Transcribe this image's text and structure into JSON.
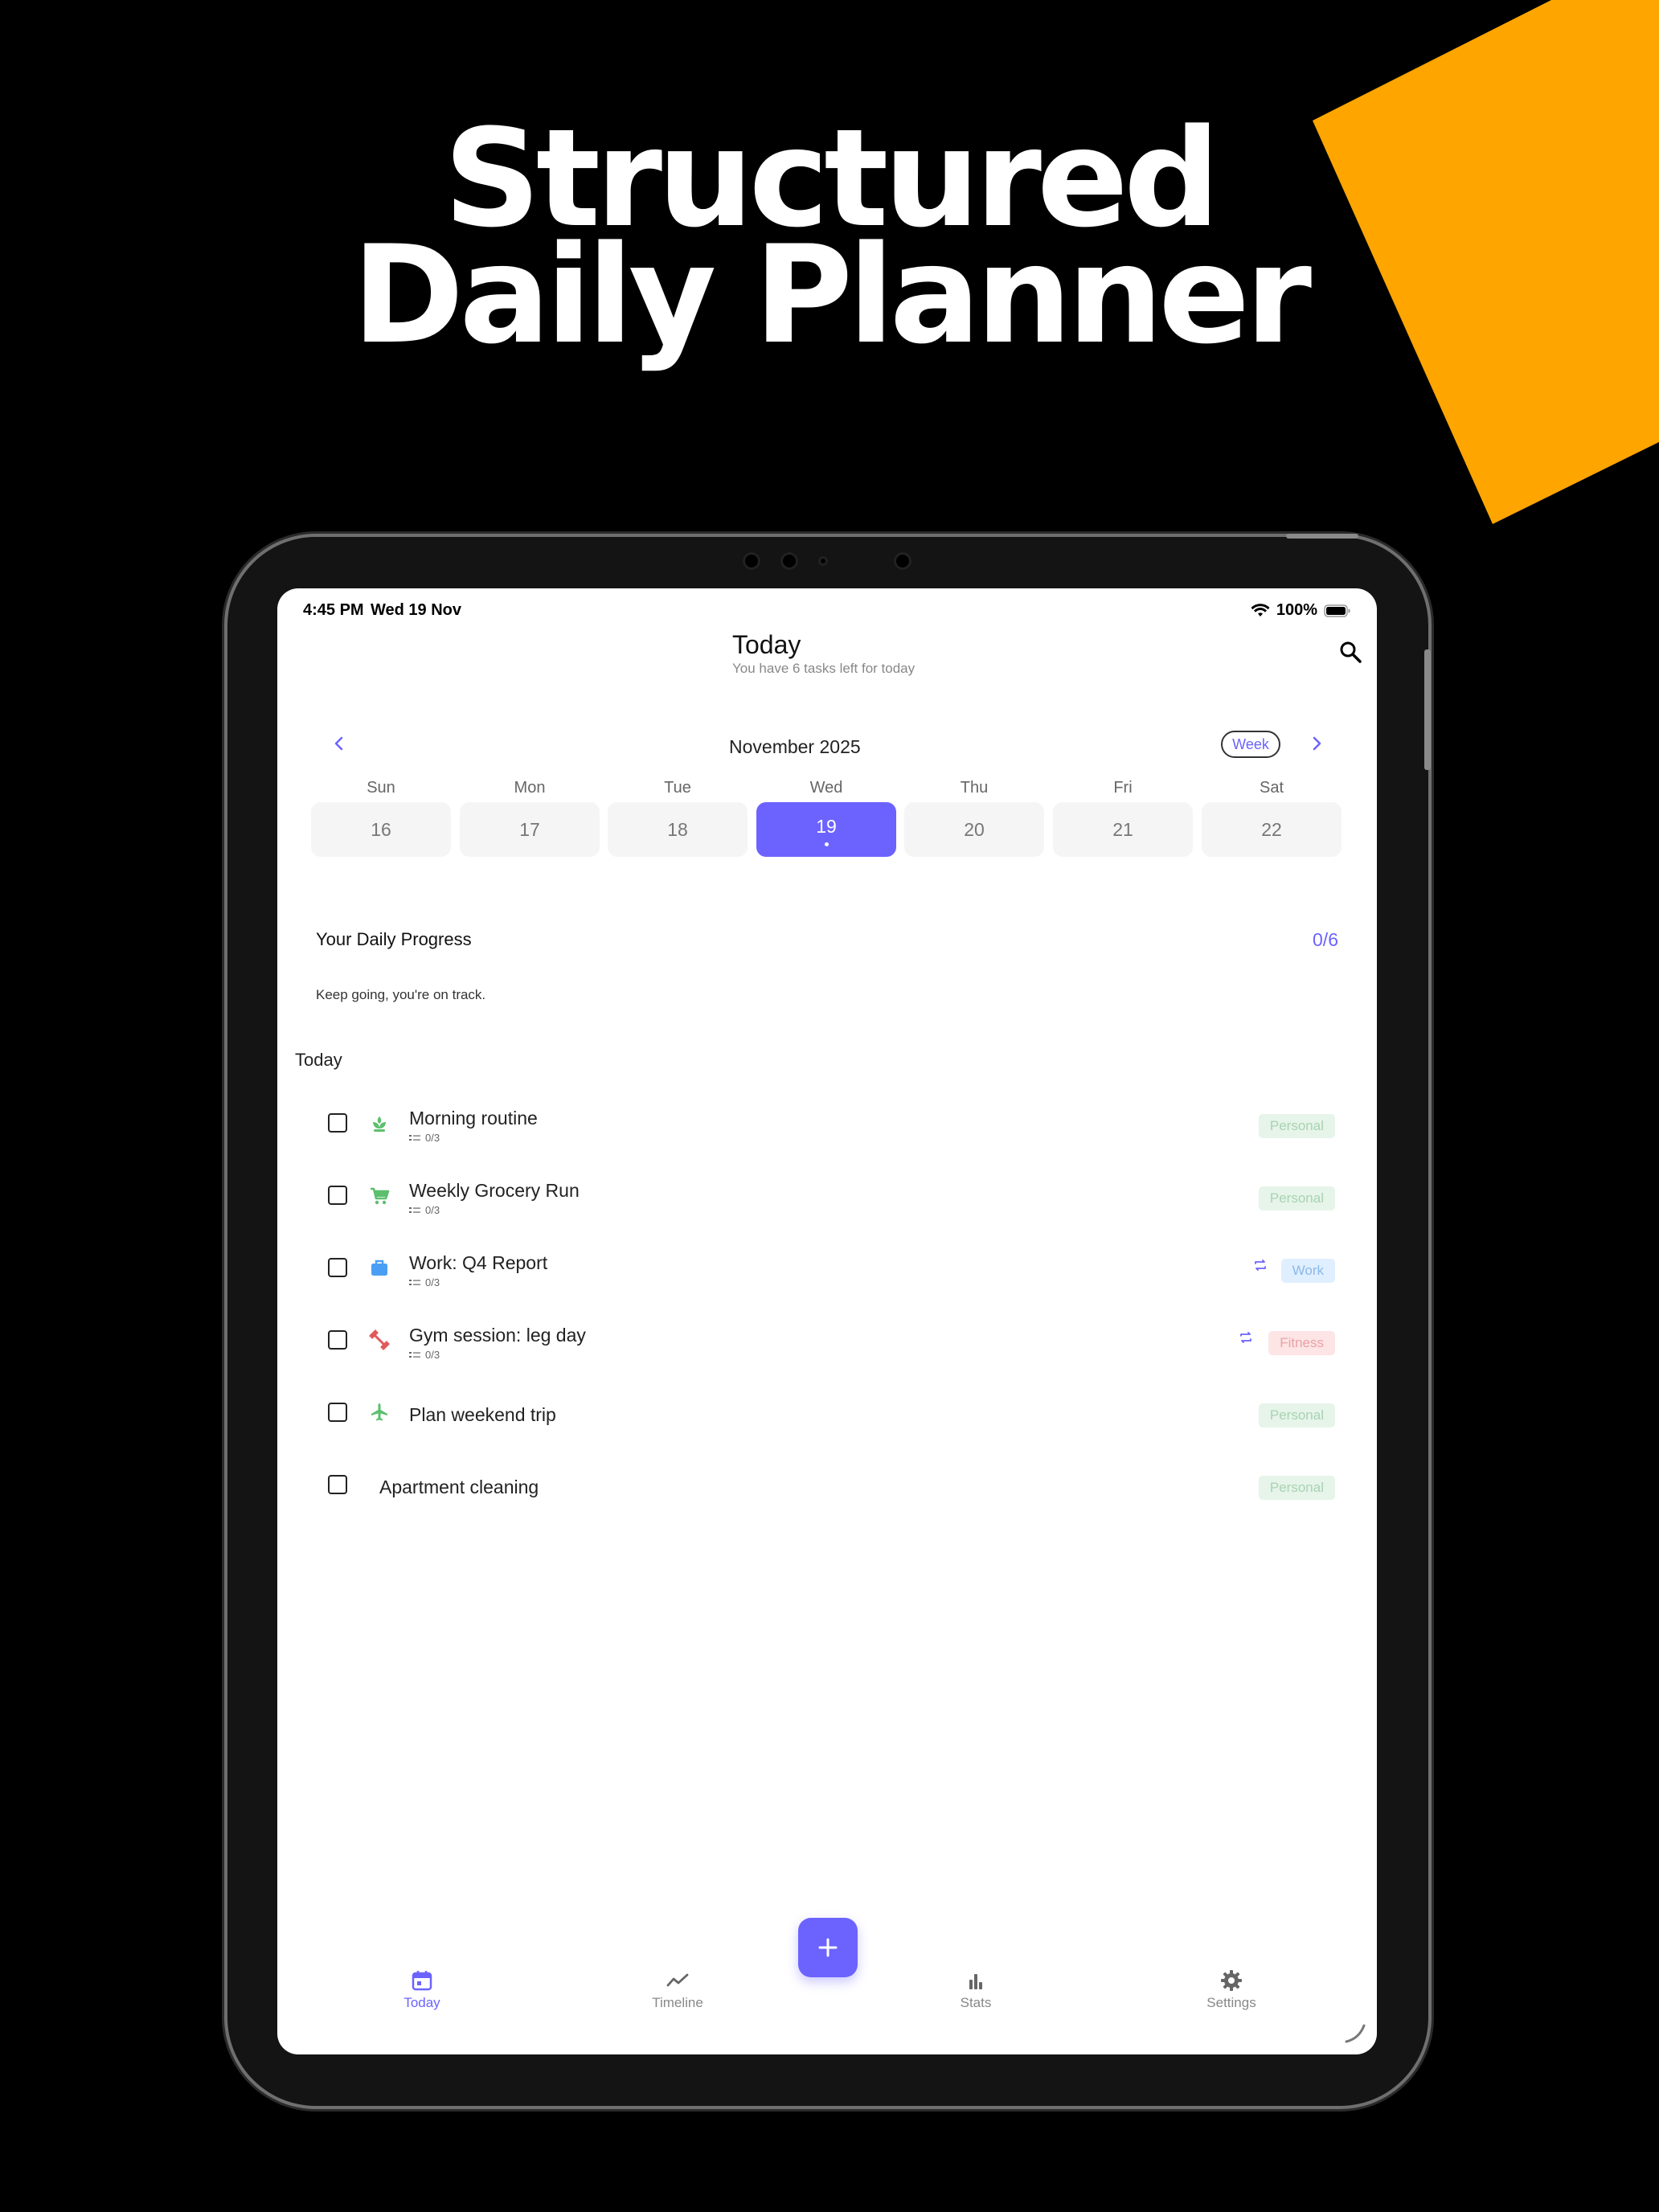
{
  "promo": {
    "headline_line1": "Structured",
    "headline_line2": "Daily Planner",
    "accent_color": "#FFA500"
  },
  "status_bar": {
    "time": "4:45 PM",
    "date": "Wed 19 Nov",
    "battery": "100%"
  },
  "header": {
    "title": "Today",
    "subtitle": "You have 6 tasks left for today"
  },
  "calendar": {
    "month": "November 2025",
    "view_mode": "Week",
    "days": [
      {
        "dow": "Sun",
        "date": "16"
      },
      {
        "dow": "Mon",
        "date": "17"
      },
      {
        "dow": "Tue",
        "date": "18"
      },
      {
        "dow": "Wed",
        "date": "19",
        "selected": true
      },
      {
        "dow": "Thu",
        "date": "20"
      },
      {
        "dow": "Fri",
        "date": "21"
      },
      {
        "dow": "Sat",
        "date": "22"
      }
    ]
  },
  "progress": {
    "title": "Your Daily Progress",
    "count": "0/6",
    "message": "Keep going, you're on track."
  },
  "tasks_section": {
    "title": "Today",
    "tasks": [
      {
        "name": "Morning routine",
        "subtasks": "0/3",
        "tag": "Personal",
        "icon": "sprout-icon",
        "icon_color": "#5cbf6e",
        "repeat": false
      },
      {
        "name": "Weekly Grocery Run",
        "subtasks": "0/3",
        "tag": "Personal",
        "icon": "cart-icon",
        "icon_color": "#5cbf6e",
        "repeat": false
      },
      {
        "name": "Work: Q4 Report",
        "subtasks": "0/3",
        "tag": "Work",
        "icon": "briefcase-icon",
        "icon_color": "#4a9ff5",
        "repeat": true
      },
      {
        "name": "Gym session: leg day",
        "subtasks": "0/3",
        "tag": "Fitness",
        "icon": "dumbbell-icon",
        "icon_color": "#e05a5a",
        "repeat": true
      },
      {
        "name": "Plan weekend trip",
        "subtasks": "",
        "tag": "Personal",
        "icon": "airplane-icon",
        "icon_color": "#5cbf6e",
        "repeat": false
      },
      {
        "name": "Apartment cleaning",
        "subtasks": "",
        "tag": "Personal",
        "icon": "",
        "icon_color": "",
        "repeat": false
      }
    ]
  },
  "tab_bar": {
    "today": "Today",
    "timeline": "Timeline",
    "stats": "Stats",
    "settings": "Settings"
  },
  "colors": {
    "accent": "#6C63FF",
    "personal_tag_bg": "#E6F4E9",
    "work_tag_bg": "#E0EFFF",
    "fitness_tag_bg": "#FDE4E5"
  }
}
